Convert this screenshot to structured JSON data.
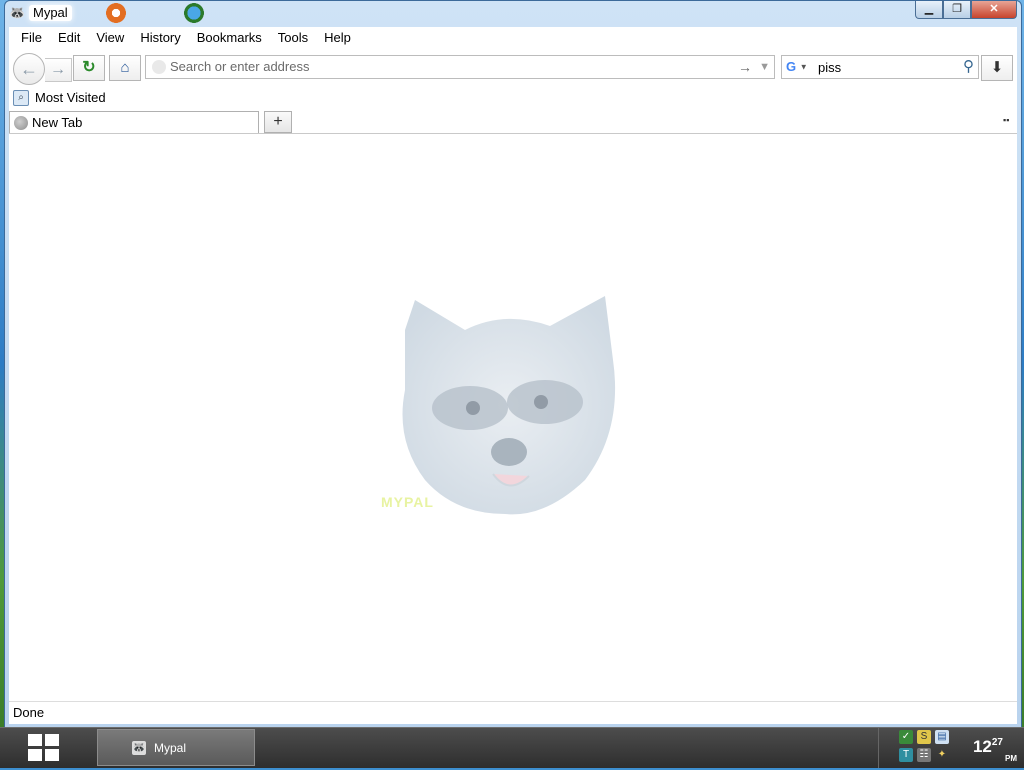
{
  "window": {
    "title": "Mypal",
    "controls": {
      "minimize": "▁",
      "maximize": "❐",
      "close": "✕"
    }
  },
  "menubar": {
    "items": [
      {
        "label": "File",
        "mnemonic": "F"
      },
      {
        "label": "Edit",
        "mnemonic": "E"
      },
      {
        "label": "View",
        "mnemonic": "V"
      },
      {
        "label": "History",
        "mnemonic": "s"
      },
      {
        "label": "Bookmarks",
        "mnemonic": "B"
      },
      {
        "label": "Tools",
        "mnemonic": "T"
      },
      {
        "label": "Help",
        "mnemonic": "H"
      }
    ]
  },
  "navbar": {
    "url_placeholder": "Search or enter address",
    "url_value": "",
    "search_engine": "G",
    "search_value": "piss"
  },
  "bookmarks": {
    "items": [
      {
        "label": "Most Visited"
      }
    ]
  },
  "tabs": [
    {
      "label": "New Tab"
    }
  ],
  "page": {
    "logo_text": "MYPAL"
  },
  "status": {
    "text": "Done"
  },
  "taskbar": {
    "items": [
      {
        "label": "Mypal"
      }
    ],
    "clock": {
      "hour": "12",
      "minute": "27",
      "ampm": "PM"
    }
  },
  "icons": {
    "back": "back-arrow-icon",
    "forward": "forward-arrow-icon",
    "reload": "reload-icon",
    "home": "home-icon",
    "go": "go-arrow-icon",
    "search": "magnifier-icon",
    "download": "download-icon",
    "new_tab": "plus-icon"
  },
  "colors": {
    "accent": "#2a5a9a",
    "reload": "#2b8a2b",
    "close_button": "#c7432c"
  }
}
